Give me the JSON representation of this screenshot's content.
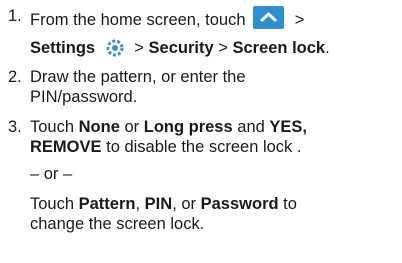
{
  "steps": [
    {
      "number": "1.",
      "line1_prefix": "From the home screen, touch",
      "line1_suffix": ">",
      "settings": "Settings",
      "gt1": ">",
      "security": "Security",
      "gt2": ">",
      "screen_lock": "Screen lock",
      "period": ".",
      "icons": [
        "apps-icon",
        "settings-gear-icon"
      ]
    },
    {
      "number": "2.",
      "line1": "Draw the pattern, or enter the",
      "line2": "PIN/password."
    },
    {
      "number": "3.",
      "touch": "Touch",
      "none": "None",
      "or": "or",
      "long_press": "Long press",
      "and": "and",
      "yes": "YES,",
      "remove": "REMOVE",
      "remove_tail": "to disable the screen lock .",
      "separator": "– or –",
      "touch2": "Touch",
      "pattern": "Pattern",
      "comma1": ",",
      "pin": "PIN",
      "comma_or": ", or",
      "password": "Password",
      "to": "to",
      "change_line": "change the screen lock."
    }
  ],
  "colors": {
    "apps_icon_bg": "#2d8fce",
    "gear_icon": "#3a8fd0"
  }
}
